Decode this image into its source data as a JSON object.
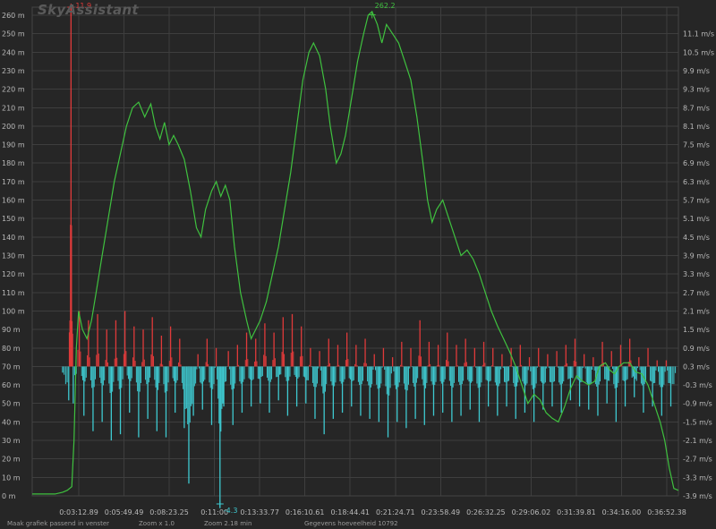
{
  "app": {
    "watermark": "SkyAssistant"
  },
  "status_bar": {
    "fit_label": "Maak grafiek passend in venster",
    "zoom_label": "Zoom x 1.0",
    "zoom_time_label": "Zoom 2.18 min",
    "data_count_label": "Gegevens hoeveelheid 10792"
  },
  "colors": {
    "background": "#262626",
    "altitude": "#3fc13f",
    "climb_positive": "#e03a3a",
    "climb_negative": "#3ec9d0",
    "grid": "#3e3e3e",
    "text": "#b9b9b9"
  },
  "chart_data": {
    "type": "line",
    "title": "",
    "xlabel": "",
    "grid": true,
    "x_ticks": [
      "0:03:12.89",
      "0:05:49.49",
      "0:08:23.25",
      "0:11:00",
      "0:13:33.77",
      "0:16:10.61",
      "0:18:44.41",
      "0:21:24.71",
      "0:23:58.49",
      "0:26:32.25",
      "0:29:06.02",
      "0:31:39.81",
      "0:34:16.00",
      "0:36:52.38"
    ],
    "x_range_min": [
      0,
      38.2
    ],
    "y_left": {
      "label": "",
      "unit": "m",
      "ticks": [
        "0 m",
        "10 m",
        "20 m",
        "30 m",
        "40 m",
        "50 m",
        "60 m",
        "70 m",
        "80 m",
        "90 m",
        "100 m",
        "110 m",
        "120 m",
        "130 m",
        "140 m",
        "150 m",
        "160 m",
        "170 m",
        "180 m",
        "190 m",
        "200 m",
        "210 m",
        "220 m",
        "230 m",
        "240 m",
        "250 m",
        "260 m"
      ],
      "range": [
        0,
        260
      ]
    },
    "y_right": {
      "label": "",
      "unit": "m/s",
      "ticks": [
        "-3.9 m/s",
        "-3.3 m/s",
        "-2.7 m/s",
        "-2.1 m/s",
        "-1.5 m/s",
        "-0.9 m/s",
        "-0.3 m/s",
        "0.3 m/s",
        "0.9 m/s",
        "1.5 m/s",
        "2.1 m/s",
        "2.7 m/s",
        "3.3 m/s",
        "3.9 m/s",
        "4.5 m/s",
        "5.1 m/s",
        "5.7 m/s",
        "6.3 m/s",
        "6.9 m/s",
        "7.5 m/s",
        "8.1 m/s",
        "8.7 m/s",
        "9.3 m/s",
        "9.9 m/s",
        "10.5 m/s",
        "11.1 m/s"
      ],
      "range": [
        -3.9,
        11.1
      ]
    },
    "annotations": {
      "max_climb": {
        "label": "11.9",
        "x_min": 2.55,
        "y_ms": 11.9
      },
      "min_climb": {
        "label": "-4.3",
        "x_min": 12.35,
        "y_ms": -4.3
      },
      "max_altitude": {
        "label": "262.2",
        "x_min": 22.35,
        "y_m": 262.2
      }
    },
    "series": [
      {
        "role": "altitude",
        "axis": "left",
        "points": [
          [
            0,
            1
          ],
          [
            1.0,
            1
          ],
          [
            1.5,
            1
          ],
          [
            2.0,
            2
          ],
          [
            2.3,
            3
          ],
          [
            2.6,
            5
          ],
          [
            2.75,
            30
          ],
          [
            2.9,
            80
          ],
          [
            3.05,
            100
          ],
          [
            3.3,
            90
          ],
          [
            3.6,
            85
          ],
          [
            3.9,
            95
          ],
          [
            4.2,
            110
          ],
          [
            4.6,
            130
          ],
          [
            5.0,
            150
          ],
          [
            5.4,
            170
          ],
          [
            5.8,
            185
          ],
          [
            6.2,
            200
          ],
          [
            6.6,
            210
          ],
          [
            7.0,
            213
          ],
          [
            7.4,
            205
          ],
          [
            7.8,
            212
          ],
          [
            8.1,
            200
          ],
          [
            8.4,
            193
          ],
          [
            8.7,
            202
          ],
          [
            9.0,
            190
          ],
          [
            9.3,
            195
          ],
          [
            9.6,
            190
          ],
          [
            10.0,
            182
          ],
          [
            10.4,
            165
          ],
          [
            10.8,
            145
          ],
          [
            11.1,
            140
          ],
          [
            11.4,
            155
          ],
          [
            11.8,
            165
          ],
          [
            12.1,
            170
          ],
          [
            12.4,
            162
          ],
          [
            12.7,
            168
          ],
          [
            13.0,
            160
          ],
          [
            13.3,
            135
          ],
          [
            13.7,
            110
          ],
          [
            14.1,
            95
          ],
          [
            14.4,
            85
          ],
          [
            14.7,
            90
          ],
          [
            15.0,
            95
          ],
          [
            15.4,
            105
          ],
          [
            15.8,
            120
          ],
          [
            16.2,
            135
          ],
          [
            16.6,
            155
          ],
          [
            17.0,
            175
          ],
          [
            17.4,
            200
          ],
          [
            17.8,
            225
          ],
          [
            18.2,
            240
          ],
          [
            18.5,
            245
          ],
          [
            18.9,
            238
          ],
          [
            19.3,
            220
          ],
          [
            19.6,
            200
          ],
          [
            20.0,
            180
          ],
          [
            20.3,
            185
          ],
          [
            20.6,
            195
          ],
          [
            21.0,
            215
          ],
          [
            21.4,
            235
          ],
          [
            21.8,
            250
          ],
          [
            22.1,
            260
          ],
          [
            22.35,
            262
          ],
          [
            22.7,
            255
          ],
          [
            23.0,
            245
          ],
          [
            23.3,
            255
          ],
          [
            23.7,
            250
          ],
          [
            24.1,
            245
          ],
          [
            24.5,
            235
          ],
          [
            24.9,
            225
          ],
          [
            25.3,
            205
          ],
          [
            25.7,
            180
          ],
          [
            26.0,
            160
          ],
          [
            26.3,
            148
          ],
          [
            26.6,
            155
          ],
          [
            27.0,
            160
          ],
          [
            27.4,
            150
          ],
          [
            27.8,
            140
          ],
          [
            28.2,
            130
          ],
          [
            28.6,
            133
          ],
          [
            29.0,
            128
          ],
          [
            29.4,
            120
          ],
          [
            29.8,
            110
          ],
          [
            30.2,
            100
          ],
          [
            30.6,
            92
          ],
          [
            31.0,
            85
          ],
          [
            31.4,
            78
          ],
          [
            31.8,
            70
          ],
          [
            32.2,
            60
          ],
          [
            32.6,
            50
          ],
          [
            33.0,
            55
          ],
          [
            33.4,
            52
          ],
          [
            33.8,
            45
          ],
          [
            34.2,
            42
          ],
          [
            34.6,
            40
          ],
          [
            35.0,
            48
          ],
          [
            35.4,
            58
          ],
          [
            35.8,
            65
          ],
          [
            36.2,
            62
          ],
          [
            36.6,
            60
          ],
          [
            37.0,
            62
          ],
          [
            37.3,
            70
          ],
          [
            37.7,
            72
          ],
          [
            38.0,
            68
          ],
          [
            38.3,
            66
          ],
          [
            38.6,
            70
          ],
          [
            38.9,
            72
          ],
          [
            39.3,
            72
          ],
          [
            39.7,
            67
          ],
          [
            40.1,
            66
          ],
          [
            40.5,
            60
          ],
          [
            40.9,
            50
          ],
          [
            41.3,
            40
          ],
          [
            41.6,
            30
          ],
          [
            41.9,
            15
          ],
          [
            42.2,
            4
          ],
          [
            42.5,
            3
          ]
        ]
      },
      {
        "role": "climb_rate_envelope",
        "axis": "right",
        "points": [
          [
            2.0,
            0.1
          ],
          [
            2.4,
            -0.8
          ],
          [
            2.55,
            11.9
          ],
          [
            2.7,
            -0.9
          ],
          [
            3.1,
            2.1
          ],
          [
            3.4,
            -1.3
          ],
          [
            3.7,
            1.8
          ],
          [
            4.0,
            -1.8
          ],
          [
            4.3,
            2.0
          ],
          [
            4.6,
            -1.5
          ],
          [
            4.9,
            1.5
          ],
          [
            5.2,
            -2.1
          ],
          [
            5.5,
            1.8
          ],
          [
            5.8,
            -1.9
          ],
          [
            6.1,
            2.1
          ],
          [
            6.4,
            -1.2
          ],
          [
            6.7,
            1.6
          ],
          [
            7.0,
            -2.0
          ],
          [
            7.3,
            1.5
          ],
          [
            7.6,
            -1.4
          ],
          [
            7.9,
            1.9
          ],
          [
            8.2,
            -1.8
          ],
          [
            8.5,
            1.3
          ],
          [
            8.8,
            -2.0
          ],
          [
            9.1,
            1.6
          ],
          [
            9.4,
            -1.2
          ],
          [
            9.7,
            1.2
          ],
          [
            10.0,
            -1.7
          ],
          [
            10.3,
            -3.5
          ],
          [
            10.6,
            -1.3
          ],
          [
            10.9,
            0.7
          ],
          [
            11.2,
            -1.1
          ],
          [
            11.5,
            1.2
          ],
          [
            11.8,
            -1.6
          ],
          [
            12.1,
            0.9
          ],
          [
            12.35,
            -4.3
          ],
          [
            12.6,
            -1.0
          ],
          [
            12.9,
            0.8
          ],
          [
            13.2,
            -1.6
          ],
          [
            13.5,
            1.0
          ],
          [
            13.8,
            -1.2
          ],
          [
            14.1,
            1.4
          ],
          [
            14.4,
            -1.0
          ],
          [
            14.7,
            1.2
          ],
          [
            15.0,
            -0.9
          ],
          [
            15.3,
            1.7
          ],
          [
            15.6,
            -1.2
          ],
          [
            15.9,
            1.4
          ],
          [
            16.2,
            -0.8
          ],
          [
            16.5,
            1.9
          ],
          [
            16.8,
            -1.3
          ],
          [
            17.1,
            2.0
          ],
          [
            17.4,
            -1.0
          ],
          [
            17.7,
            1.6
          ],
          [
            18.0,
            -0.9
          ],
          [
            18.3,
            0.9
          ],
          [
            18.6,
            -1.4
          ],
          [
            18.9,
            0.8
          ],
          [
            19.2,
            -1.9
          ],
          [
            19.5,
            1.2
          ],
          [
            19.8,
            -1.4
          ],
          [
            20.1,
            1.0
          ],
          [
            20.4,
            -1.2
          ],
          [
            20.7,
            1.4
          ],
          [
            21.0,
            -1.0
          ],
          [
            21.3,
            1.0
          ],
          [
            21.6,
            -1.3
          ],
          [
            21.9,
            1.2
          ],
          [
            22.2,
            -1.4
          ],
          [
            22.5,
            0.7
          ],
          [
            22.8,
            -1.5
          ],
          [
            23.1,
            0.9
          ],
          [
            23.4,
            -2.0
          ],
          [
            23.7,
            0.6
          ],
          [
            24.0,
            -1.5
          ],
          [
            24.3,
            1.1
          ],
          [
            24.6,
            -1.7
          ],
          [
            24.9,
            0.9
          ],
          [
            25.2,
            -1.4
          ],
          [
            25.5,
            1.8
          ],
          [
            25.8,
            -1.6
          ],
          [
            26.1,
            1.1
          ],
          [
            26.4,
            -1.3
          ],
          [
            26.7,
            1.0
          ],
          [
            27.0,
            -1.2
          ],
          [
            27.3,
            1.4
          ],
          [
            27.6,
            -1.5
          ],
          [
            27.9,
            1.0
          ],
          [
            28.2,
            -1.3
          ],
          [
            28.5,
            1.2
          ],
          [
            28.8,
            -1.1
          ],
          [
            29.1,
            0.9
          ],
          [
            29.4,
            -1.5
          ],
          [
            29.7,
            1.1
          ],
          [
            30.0,
            -1.0
          ],
          [
            30.3,
            0.9
          ],
          [
            30.6,
            -1.3
          ],
          [
            30.9,
            0.7
          ],
          [
            31.2,
            -1.0
          ],
          [
            31.5,
            0.9
          ],
          [
            31.8,
            -1.4
          ],
          [
            32.1,
            1.0
          ],
          [
            32.4,
            -1.2
          ],
          [
            32.7,
            0.6
          ],
          [
            33.0,
            -1.5
          ],
          [
            33.3,
            0.9
          ],
          [
            33.6,
            -1.1
          ],
          [
            33.9,
            0.7
          ],
          [
            34.2,
            -1.0
          ],
          [
            34.5,
            0.8
          ],
          [
            34.8,
            -1.2
          ],
          [
            35.1,
            1.0
          ],
          [
            35.4,
            -0.8
          ],
          [
            35.7,
            1.2
          ],
          [
            36.0,
            -1.0
          ],
          [
            36.3,
            0.7
          ],
          [
            36.6,
            -1.1
          ],
          [
            36.9,
            0.6
          ],
          [
            37.2,
            -1.3
          ],
          [
            37.5,
            1.1
          ],
          [
            37.8,
            -0.9
          ],
          [
            38.1,
            0.8
          ],
          [
            38.4,
            -1.5
          ],
          [
            38.7,
            1.0
          ],
          [
            39.0,
            -1.0
          ],
          [
            39.3,
            1.2
          ],
          [
            39.6,
            -0.7
          ],
          [
            39.9,
            0.6
          ],
          [
            40.2,
            -1.2
          ],
          [
            40.5,
            0.9
          ],
          [
            40.8,
            -1.0
          ],
          [
            41.1,
            0.5
          ],
          [
            41.4,
            -1.3
          ],
          [
            41.7,
            0.5
          ],
          [
            42.0,
            -1.0
          ],
          [
            42.4,
            0.3
          ]
        ]
      }
    ]
  }
}
